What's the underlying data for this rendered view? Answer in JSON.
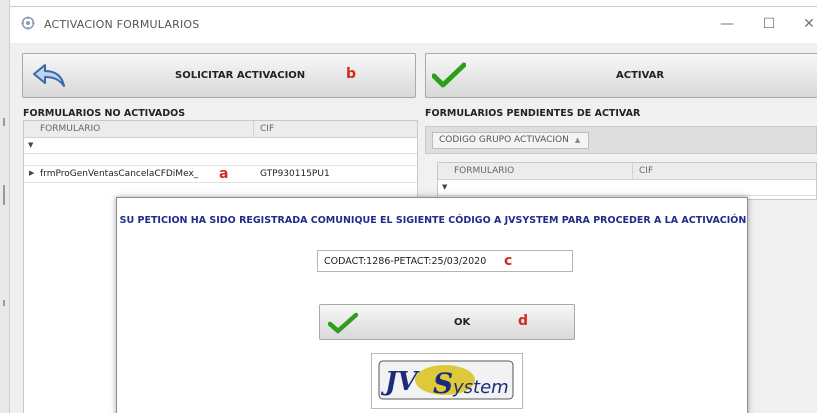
{
  "window": {
    "title": "ACTIVACION FORMULARIOS",
    "controls": {
      "minimize": "—",
      "maximize": "☐",
      "close": "✕"
    }
  },
  "toolbar": {
    "solicitar_label": "SOLICITAR ACTIVACION",
    "solicitar_marker": "b",
    "activar_label": "ACTIVAR"
  },
  "left_grid": {
    "title": "FORMULARIOS NO ACTIVADOS",
    "columns": [
      "FORMULARIO",
      "CIF"
    ],
    "rows": [
      {
        "formulario": "frmProGenVentasCancelaCFDiMex_",
        "cif": "GTP930115PU1",
        "marker": "a"
      }
    ]
  },
  "right_grid": {
    "title": "FORMULARIOS PENDIENTES DE ACTIVAR",
    "group_chip": "CODIGO GRUPO ACTIVACION",
    "columns": [
      "FORMULARIO",
      "CIF"
    ]
  },
  "dialog": {
    "message": "SU PETICION HA SIDO REGISTRADA COMUNIQUE EL SIGIENTE CÓDIGO A JVSYSTEM PARA PROCEDER A LA ACTIVACIÓN",
    "code_value": "CODACT:1286-PETACT:25/03/2020",
    "code_marker": "c",
    "ok_label": "OK",
    "ok_marker": "d",
    "logo_text": "JVSystem"
  },
  "icons": {
    "back": "back-arrow-icon",
    "check": "checkmark-icon",
    "filter": "filter-icon",
    "row_indicator": "row-pointer-icon"
  },
  "colors": {
    "marker_red": "#d42a1e",
    "dialog_text_blue": "#1f2d8a",
    "check_green": "#2e9e1c"
  }
}
